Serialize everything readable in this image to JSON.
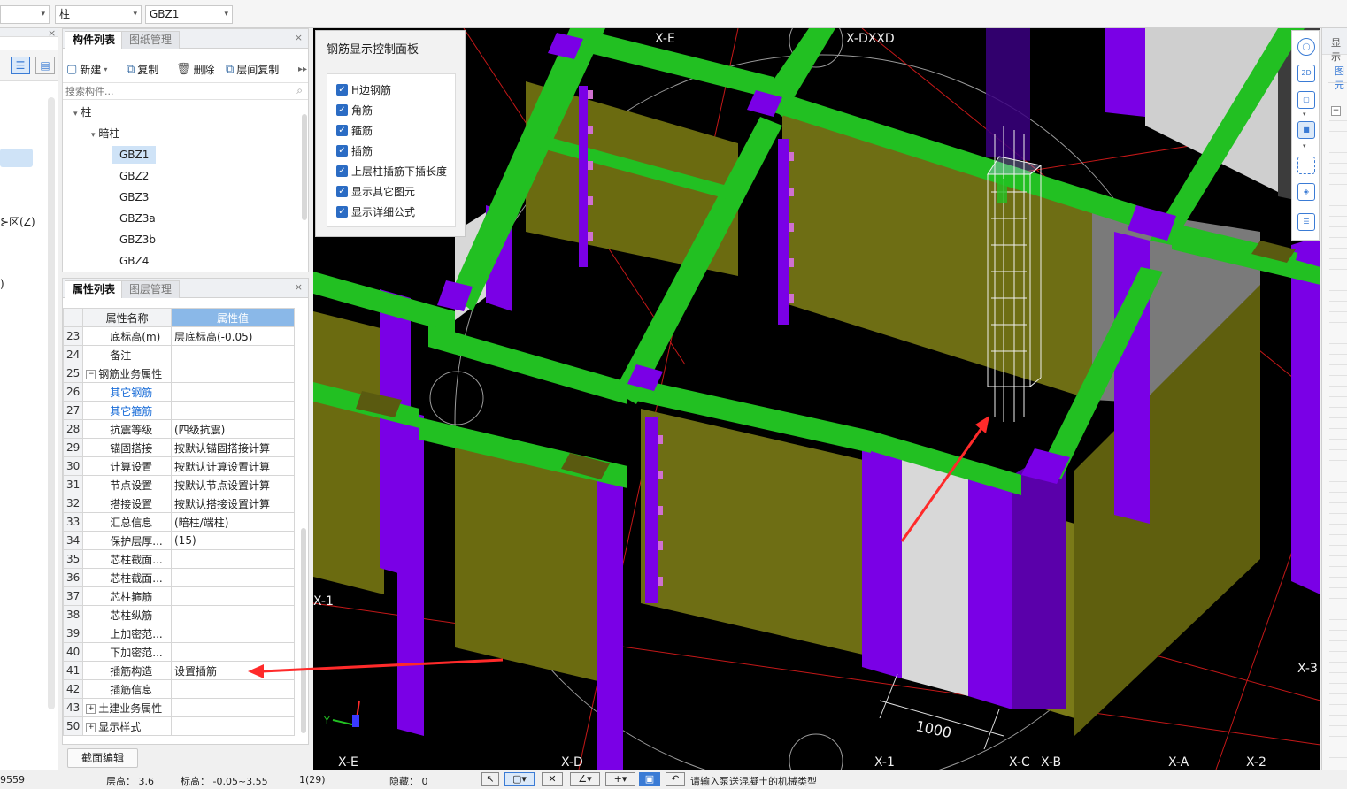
{
  "topbar": {
    "combo1_value": "",
    "combo2_value": "柱",
    "combo3_value": "GBZ1"
  },
  "leftstrip": {
    "label_zone": "⊱区(Z)",
    "label_paren": ")"
  },
  "component_panel": {
    "tabs": [
      "构件列表",
      "图纸管理"
    ],
    "toolbar": {
      "new": "新建",
      "copy": "复制",
      "delete": "删除",
      "floor_copy": "层间复制"
    },
    "search_placeholder": "搜索构件...",
    "tree": {
      "root": "柱",
      "group": "暗柱",
      "items": [
        "GBZ1",
        "GBZ2",
        "GBZ3",
        "GBZ3a",
        "GBZ3b",
        "GBZ4"
      ]
    }
  },
  "property_panel": {
    "tabs": [
      "属性列表",
      "图层管理"
    ],
    "headers": {
      "name": "属性名称",
      "value": "属性值"
    },
    "rows": [
      {
        "num": "23",
        "name": "底标高(m)",
        "value": "层底标高(-0.05)"
      },
      {
        "num": "24",
        "name": "备注",
        "value": ""
      },
      {
        "num": "25",
        "name": "钢筋业务属性",
        "value": "",
        "expand": "−"
      },
      {
        "num": "26",
        "name": "其它钢筋",
        "value": "",
        "link": true
      },
      {
        "num": "27",
        "name": "其它箍筋",
        "value": "",
        "link": true
      },
      {
        "num": "28",
        "name": "抗震等级",
        "value": "(四级抗震)"
      },
      {
        "num": "29",
        "name": "锚固搭接",
        "value": "按默认锚固搭接计算"
      },
      {
        "num": "30",
        "name": "计算设置",
        "value": "按默认计算设置计算"
      },
      {
        "num": "31",
        "name": "节点设置",
        "value": "按默认节点设置计算"
      },
      {
        "num": "32",
        "name": "搭接设置",
        "value": "按默认搭接设置计算"
      },
      {
        "num": "33",
        "name": "汇总信息",
        "value": "(暗柱/端柱)"
      },
      {
        "num": "34",
        "name": "保护层厚...",
        "value": "(15)"
      },
      {
        "num": "35",
        "name": "芯柱截面...",
        "value": ""
      },
      {
        "num": "36",
        "name": "芯柱截面...",
        "value": ""
      },
      {
        "num": "37",
        "name": "芯柱箍筋",
        "value": ""
      },
      {
        "num": "38",
        "name": "芯柱纵筋",
        "value": ""
      },
      {
        "num": "39",
        "name": "上加密范...",
        "value": ""
      },
      {
        "num": "40",
        "name": "下加密范...",
        "value": ""
      },
      {
        "num": "41",
        "name": "插筋构造",
        "value": "设置插筋"
      },
      {
        "num": "42",
        "name": "插筋信息",
        "value": ""
      },
      {
        "num": "43",
        "name": "土建业务属性",
        "value": "",
        "expand": "+"
      },
      {
        "num": "50",
        "name": "显示样式",
        "value": "",
        "expand": "+"
      }
    ],
    "section_edit_button": "截面编辑"
  },
  "rebar_panel": {
    "title": "钢筋显示控制面板",
    "options": [
      "H边钢筋",
      "角筋",
      "箍筋",
      "插筋",
      "上层柱插筋下插长度",
      "显示其它图元",
      "显示详细公式"
    ]
  },
  "viewport": {
    "axis_labels_top": [
      "X-E",
      "X-DXXD"
    ],
    "axis_labels_bottom": [
      "X-E",
      "X-D",
      "X-1",
      "X-C",
      "X-B",
      "X-A",
      "X-2"
    ],
    "axis_label_left": "X-1",
    "axis_label_right": "X-3",
    "dimension": "1000"
  },
  "statusbar": {
    "coord": "9559",
    "floor_height": "层高：  3.6",
    "elevation": "标高：  -0.05~3.55",
    "count": "1(29)",
    "hidden": "隐藏：  0",
    "prompt": "请输入泵送混凝土的机械类型"
  },
  "rightpanel": {
    "label1": "显示",
    "label2": "图元"
  },
  "colors": {
    "green": "#22c022",
    "purple": "#7a00e6",
    "olive": "#6b6b10",
    "grey": "#d8d8d8",
    "arrow": "#ff2a2a"
  }
}
